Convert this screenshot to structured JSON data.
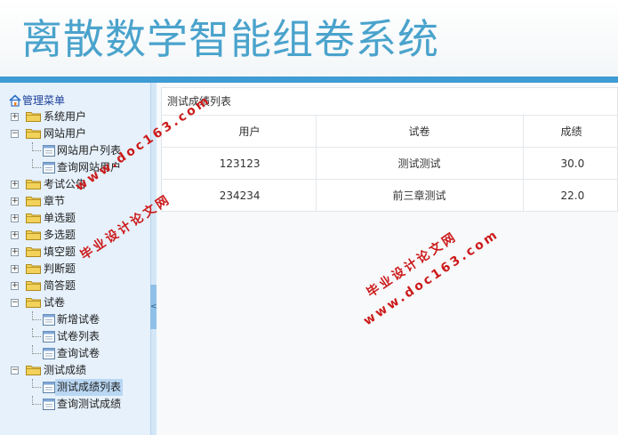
{
  "header": {
    "title": "离散数学智能组卷系统"
  },
  "sidebar": {
    "root_label": "管理菜单",
    "items": [
      {
        "label": "系统用户",
        "expander": "+"
      },
      {
        "label": "网站用户",
        "expander": "−",
        "children": [
          {
            "label": "网站用户列表"
          },
          {
            "label": "查询网站用户"
          }
        ]
      },
      {
        "label": "考试公告",
        "expander": "+"
      },
      {
        "label": "章节",
        "expander": "+"
      },
      {
        "label": "单选题",
        "expander": "+"
      },
      {
        "label": "多选题",
        "expander": "+"
      },
      {
        "label": "填空题",
        "expander": "+"
      },
      {
        "label": "判断题",
        "expander": "+"
      },
      {
        "label": "简答题",
        "expander": "+"
      },
      {
        "label": "试卷",
        "expander": "−",
        "children": [
          {
            "label": "新增试卷"
          },
          {
            "label": "试卷列表"
          },
          {
            "label": "查询试卷"
          }
        ]
      },
      {
        "label": "测试成绩",
        "expander": "−",
        "children": [
          {
            "label": "测试成绩列表",
            "selected": true
          },
          {
            "label": "查询测试成绩"
          }
        ]
      }
    ],
    "collapse_glyph": "<"
  },
  "main": {
    "panel_title": "测试成绩列表",
    "table": {
      "headers": [
        "用户",
        "试卷",
        "成绩"
      ],
      "rows": [
        [
          "123123",
          "测试测试",
          "30.0"
        ],
        [
          "234234",
          "前三章测试",
          "22.0"
        ]
      ]
    }
  },
  "watermarks": {
    "site": "www.doc163.com",
    "name": "毕业设计论文网"
  },
  "colors": {
    "title": "#4aa3cc",
    "header_bar": "#3e9bd3",
    "sidebar_bg": "#e6f1fb",
    "watermark": "#cc1a1a"
  }
}
